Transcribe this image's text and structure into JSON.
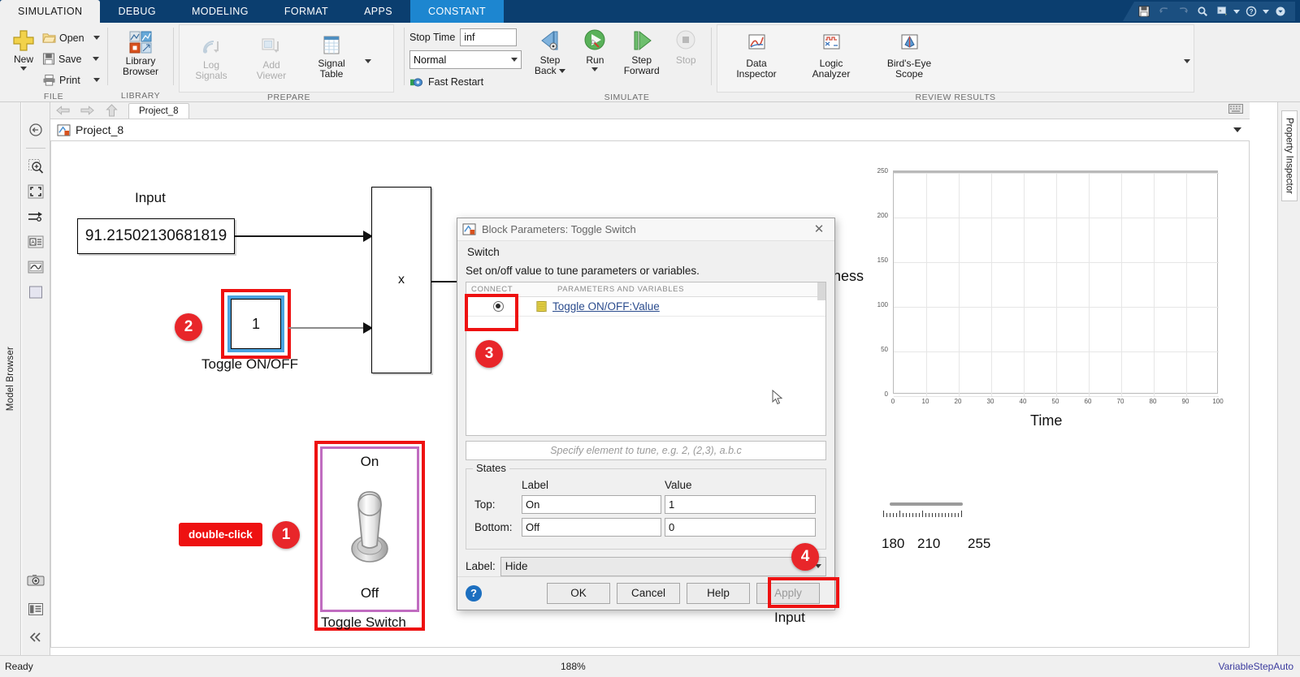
{
  "window": {
    "tabs": [
      {
        "id": "simulation",
        "label": "SIMULATION",
        "state": "active-white"
      },
      {
        "id": "debug",
        "label": "DEBUG",
        "state": "normal"
      },
      {
        "id": "modeling",
        "label": "MODELING",
        "state": "normal"
      },
      {
        "id": "format",
        "label": "FORMAT",
        "state": "normal"
      },
      {
        "id": "apps",
        "label": "APPS",
        "state": "normal"
      },
      {
        "id": "constant",
        "label": "CONSTANT",
        "state": "active-blue"
      }
    ],
    "quick_access": [
      "save-icon",
      "undo-icon",
      "redo-icon",
      "search-icon",
      "shortcuts-icon",
      "help-icon",
      "expand-icon"
    ]
  },
  "ribbon": {
    "file": {
      "group_label": "FILE",
      "new_label": "New",
      "open_label": "Open",
      "save_label": "Save",
      "print_label": "Print"
    },
    "library": {
      "group_label": "LIBRARY",
      "browser_label_line1": "Library",
      "browser_label_line2": "Browser"
    },
    "prepare": {
      "group_label": "PREPARE",
      "items": [
        {
          "line1": "Log",
          "line2": "Signals",
          "disabled": true
        },
        {
          "line1": "Add",
          "line2": "Viewer",
          "disabled": true
        },
        {
          "line1": "Signal",
          "line2": "Table",
          "disabled": false
        }
      ]
    },
    "simulate": {
      "group_label": "SIMULATE",
      "stop_time_label": "Stop Time",
      "stop_time_value": "inf",
      "mode_value": "Normal",
      "fast_restart_label": "Fast Restart",
      "items": [
        {
          "line1": "Step",
          "line2": "Back",
          "caret": true,
          "disabled": false
        },
        {
          "line1": "Run",
          "line2": "",
          "caret": true,
          "disabled": false
        },
        {
          "line1": "Step",
          "line2": "Forward",
          "caret": false,
          "disabled": false
        },
        {
          "line1": "Stop",
          "line2": "",
          "caret": false,
          "disabled": true
        }
      ]
    },
    "review": {
      "group_label": "REVIEW RESULTS",
      "items": [
        {
          "line1": "Data",
          "line2": "Inspector"
        },
        {
          "line1": "Logic",
          "line2": "Analyzer"
        },
        {
          "line1": "Bird's-Eye",
          "line2": "Scope"
        }
      ]
    }
  },
  "left_rail": {
    "model_browser_label": "Model Browser",
    "tools": [
      "hide-panel-icon",
      "zoom-fit-icon",
      "fit-to-view-icon",
      "signal-routing-icon",
      "annotation-icon",
      "scope-preview-icon",
      "subsystem-icon",
      "camera-icon",
      "report-icon",
      "collapse-icon"
    ]
  },
  "right_rail": {
    "property_inspector_label": "Property Inspector"
  },
  "nav": {
    "project_tab": "Project_8",
    "breadcrumb": "Project_8"
  },
  "canvas": {
    "input_label": "Input",
    "display_value": "91.21502130681819",
    "constant_value": "1",
    "constant_label": "Toggle ON/OFF",
    "product_symbol": "x",
    "toggle_switch": {
      "on_label": "On",
      "off_label": "Off",
      "block_label": "Toggle Switch"
    },
    "callout_double_click": "double-click",
    "badges": [
      "1",
      "2",
      "3",
      "4"
    ],
    "bottom_input_label": "Input",
    "gauge_ticks": [
      "180",
      "210",
      "255"
    ]
  },
  "chart_data": {
    "type": "line",
    "title": "",
    "xlabel": "Time",
    "ylabel": "Fitness",
    "xlim": [
      0,
      100
    ],
    "ylim": [
      0,
      250
    ],
    "xticks": [
      0,
      10,
      20,
      30,
      40,
      50,
      60,
      70,
      80,
      90,
      100
    ],
    "yticks": [
      0,
      50,
      100,
      150,
      200,
      250
    ],
    "grid": true,
    "legend": "none",
    "series": [
      {
        "name": "Fitness",
        "x": [],
        "y": []
      }
    ]
  },
  "dialog": {
    "title": "Block Parameters: Toggle Switch",
    "group_legend": "Switch",
    "description": "Set on/off value to tune parameters or variables.",
    "table": {
      "columns": [
        "CONNECT",
        "",
        "PARAMETERS AND VARIABLES"
      ],
      "rows": [
        {
          "connect": true,
          "icon": "variable-icon",
          "name": "Toggle ON/OFF:Value"
        }
      ]
    },
    "hint": "Specify element to tune, e.g. 2, (2,3), a.b.c",
    "states": {
      "legend": "States",
      "col_label": "Label",
      "col_value": "Value",
      "rows": [
        {
          "row_label": "Top:",
          "label": "On",
          "value": "1"
        },
        {
          "row_label": "Bottom:",
          "label": "Off",
          "value": "0"
        }
      ]
    },
    "label_row": {
      "label": "Label:",
      "value": "Hide"
    },
    "buttons": {
      "ok": "OK",
      "cancel": "Cancel",
      "help": "Help",
      "apply": "Apply"
    }
  },
  "status": {
    "left": "Ready",
    "zoom": "188%",
    "solver": "VariableStepAuto"
  }
}
